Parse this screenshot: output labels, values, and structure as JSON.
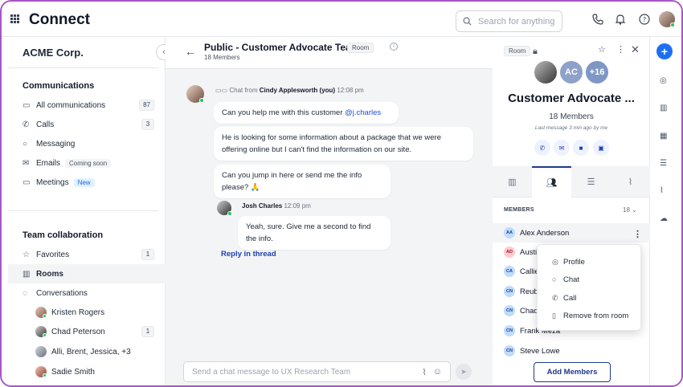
{
  "app": {
    "title": "Connect"
  },
  "search": {
    "placeholder": "Search for anything"
  },
  "sidebar": {
    "org": "ACME Corp.",
    "communications_title": "Communications",
    "communications": [
      {
        "label": "All communications",
        "count": "87",
        "icon": "message-square-icon"
      },
      {
        "label": "Calls",
        "count": "3",
        "icon": "phone-icon"
      },
      {
        "label": "Messaging",
        "icon": "chat-bubble-icon"
      },
      {
        "label": "Emails",
        "tag": "Coming soon",
        "icon": "mail-icon"
      },
      {
        "label": "Meetings",
        "tag": "New",
        "icon": "video-icon"
      }
    ],
    "collab_title": "Team collaboration",
    "collab": [
      {
        "label": "Favorites",
        "count": "1",
        "icon": "star-icon"
      },
      {
        "label": "Rooms",
        "icon": "building-icon"
      },
      {
        "label": "Conversations",
        "icon": "chat-bubbles-icon"
      }
    ],
    "conversations": [
      {
        "label": "Kristen Rogers"
      },
      {
        "label": "Chad Peterson",
        "count": "1"
      },
      {
        "label": "Alli, Brent, Jessica, +3"
      },
      {
        "label": "Sadie Smith"
      }
    ]
  },
  "chat": {
    "title": "Public - Customer Advocate Team",
    "room_tag": "Room",
    "members": "18 Members",
    "thread": {
      "from_prefix": "Chat from",
      "author": "Cindy Applesworth (you)",
      "time": "12:08 pm",
      "m1_text": "Can you help me with this customer ",
      "m1_mention": "@j.charles",
      "m2": "He is looking for some information about a package that we were offering online but I can't find the information on our site.",
      "m3": "Can you jump in here or send me the info please? 🙏"
    },
    "reply": {
      "author": "Josh Charles",
      "time": "12:09 pm",
      "text": "Yeah, sure. Give me a second to find the info."
    },
    "reply_link": "Reply in thread",
    "composer_placeholder": "Send a chat message to UX Research Team"
  },
  "panel": {
    "room_tag": "Room",
    "avatar_initials": "AC",
    "avatar_more": "+16",
    "title": "Customer Advocate ...",
    "members": "18 Members",
    "last_message": "Last message 3 min ago by me",
    "members_heading": "MEMBERS",
    "members_count": "18",
    "member_list": [
      {
        "initials": "AA",
        "name": "Alex Anderson",
        "color": "#bfdbfe"
      },
      {
        "initials": "AD",
        "name": "Austi",
        "color": "#fecaca"
      },
      {
        "initials": "CA",
        "name": "Callie",
        "color": "#bfdbfe"
      },
      {
        "initials": "CN",
        "name": "Reub",
        "color": "#bfdbfe"
      },
      {
        "initials": "CN",
        "name": "Chad",
        "color": "#bfdbfe"
      },
      {
        "initials": "CN",
        "name": "Frank Meza",
        "color": "#bfdbfe"
      },
      {
        "initials": "CN",
        "name": "Steve Lowe",
        "color": "#bfdbfe"
      }
    ],
    "add_members": "Add Members",
    "context_menu": [
      {
        "label": "Profile",
        "icon": "user-circle-icon"
      },
      {
        "label": "Chat",
        "icon": "chat-bubble-icon"
      },
      {
        "label": "Call",
        "icon": "phone-icon"
      },
      {
        "label": "Remove from room",
        "icon": "trash-icon"
      }
    ]
  },
  "colors": {
    "accent": "#1e3a8a",
    "primary_blue": "#1d6ff2",
    "frame": "#a855c7"
  }
}
